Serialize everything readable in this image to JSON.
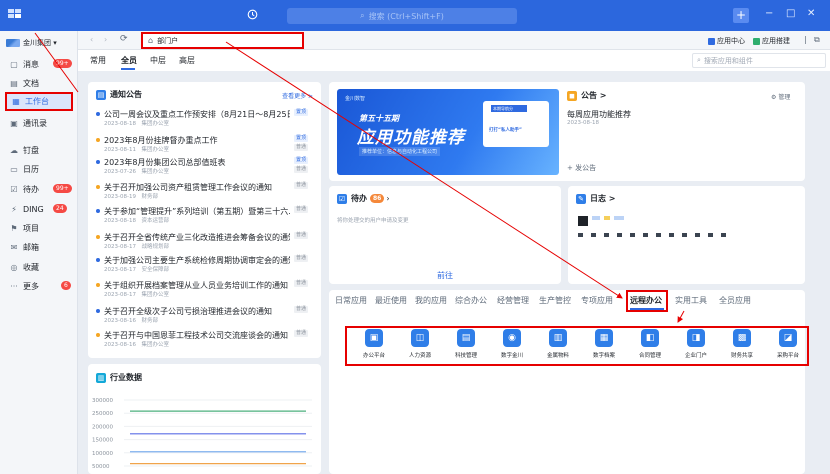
{
  "titlebar": {
    "search_placeholder": "搜索 (Ctrl+Shift+F)",
    "plus": "+",
    "minimize": "−",
    "maximize": "□",
    "close": "✕",
    "history_icon": "clock-icon"
  },
  "sidebar": {
    "org_name": "金川集团 ▾",
    "items": [
      {
        "label": "消息",
        "icon": "message-icon",
        "badge": "99+"
      },
      {
        "label": "文档",
        "icon": "document-icon"
      },
      {
        "label": "工作台",
        "icon": "grid-icon",
        "active": true
      },
      {
        "label": "通讯录",
        "icon": "contacts-icon"
      },
      {
        "label": "钉盘",
        "icon": "cloud-drive-icon"
      },
      {
        "label": "日历",
        "icon": "calendar-icon"
      },
      {
        "label": "待办",
        "icon": "todo-icon",
        "badge": "99+"
      },
      {
        "label": "DING",
        "icon": "ding-icon",
        "badge": "24"
      },
      {
        "label": "项目",
        "icon": "project-icon"
      },
      {
        "label": "邮箱",
        "icon": "mail-icon"
      },
      {
        "label": "收藏",
        "icon": "favorite-icon"
      },
      {
        "label": "更多",
        "icon": "more-icon",
        "badge": "6"
      }
    ]
  },
  "tabstrip": {
    "back": "‹",
    "forward": "›",
    "page_tab_label": "部门户",
    "app_center": "应用中心",
    "app_build": "应用搭建"
  },
  "subtabs": {
    "tabs": [
      "常用",
      "全员",
      "中层",
      "高层"
    ],
    "active": "全员",
    "search_placeholder": "搜索应用和组件"
  },
  "notice": {
    "title": "通知公告",
    "more": "查看更多 >",
    "items": [
      {
        "title": "公司一周会议及重点工作预安排（8月21日～8月25日）",
        "meta": "2023-08-18　集团办公室",
        "tag": "置顶",
        "tag2": "",
        "dot": "#2f6ae0"
      },
      {
        "title": "2023年8月份挂牌督办重点工作",
        "meta": "2023-08-11　集团办公室",
        "tag": "置顶",
        "tag2": "普通",
        "dot": "#f5a623"
      },
      {
        "title": "2023年8月份集团公司总部值班表",
        "meta": "2023-07-26　集团办公室",
        "tag": "置顶",
        "tag2": "普通",
        "dot": "#2f6ae0"
      },
      {
        "title": "关于召开加强公司资产租赁管理工作会议的通知",
        "meta": "2023-08-19　财务部",
        "tag": "普通",
        "tag2": "",
        "dot": "#f5a623"
      },
      {
        "title": "关于参加“管理提升”系列培训（第五期）暨第三十六...",
        "meta": "2023-08-18　资本运营部",
        "tag": "普通",
        "tag2": "",
        "dot": "#2f6ae0"
      },
      {
        "title": "关于召开全省传统产业三化改造推进会筹备会议的通知",
        "meta": "2023-08-17　战略规划部",
        "tag": "普通",
        "tag2": "",
        "dot": "#f5a623"
      },
      {
        "title": "关于加强公司主要生产系统检修周期协调审定会的通知",
        "meta": "2023-08-17　安全保障部",
        "tag": "普通",
        "tag2": "",
        "dot": "#2f6ae0"
      },
      {
        "title": "关于组织开展档案管理从业人员业务培训工作的通知",
        "meta": "2023-08-17　集团办公室",
        "tag": "普通",
        "tag2": "",
        "dot": "#f5a623"
      },
      {
        "title": "关于召开全级次子公司亏损治理推进会议的通知",
        "meta": "2023-08-16　财务部",
        "tag": "普通",
        "tag2": "",
        "dot": "#2f6ae0"
      },
      {
        "title": "关于召开与中国恩菲工程技术公司交流座谈会的通知",
        "meta": "2023-08-16　集团办公室",
        "tag": "普通",
        "tag2": "",
        "dot": "#f5a623"
      }
    ]
  },
  "banner": {
    "logo": "金川数智",
    "small": "第五十五期",
    "big": "应用功能推荐",
    "sub": "推荐单位：信息与自动化工程公司",
    "card_head": "本期导航分",
    "card_text": "打打“私人助手”"
  },
  "announce": {
    "title": "公告 >",
    "manage": "管理",
    "item_title": "每周应用功能推荐",
    "item_date": "2023-08-18",
    "publish": "+ 发公告"
  },
  "todo": {
    "title": "待办",
    "badge": "86",
    "empty_text": "将你处理交的用户申请及变更",
    "go": "前往"
  },
  "diary": {
    "title": "日志 >"
  },
  "industry": {
    "title": "行业数据"
  },
  "chart_data": {
    "type": "line",
    "title": "行业数据",
    "yticks": [
      "300000",
      "250000",
      "200000",
      "150000",
      "100000",
      "50000"
    ],
    "ylim": [
      50000,
      300000
    ],
    "series": [
      {
        "color": "#4caf7d",
        "values": [
          258000,
          258000,
          258000,
          258000,
          258000
        ]
      },
      {
        "color": "#5b6ee6",
        "values": [
          172000,
          172000,
          172000,
          172000,
          172000
        ]
      },
      {
        "color": "#7fb0ee",
        "values": [
          104000,
          104000,
          104000,
          104000,
          104000
        ]
      },
      {
        "color": "#f0a44a",
        "values": [
          59000,
          59000,
          59000,
          59000,
          59000
        ]
      }
    ]
  },
  "apps": {
    "categories": [
      "日常应用",
      "最近使用",
      "我的应用",
      "综合办公",
      "经营管理",
      "生产管控",
      "专项应用",
      "远程办公",
      "实用工具",
      "全员应用"
    ],
    "active_category": "远程办公",
    "items": [
      {
        "label": "办公平台",
        "icon": "office-icon"
      },
      {
        "label": "人力资源",
        "icon": "hr-icon"
      },
      {
        "label": "科技管理",
        "icon": "tech-icon"
      },
      {
        "label": "数字金川",
        "icon": "digital-icon"
      },
      {
        "label": "金属物料",
        "icon": "material-icon"
      },
      {
        "label": "数字档案",
        "icon": "archive-icon"
      },
      {
        "label": "合同管理",
        "icon": "contract-icon"
      },
      {
        "label": "企业门户",
        "icon": "portal-icon"
      },
      {
        "label": "财务共享",
        "icon": "finance-icon"
      },
      {
        "label": "采购平台",
        "icon": "purchase-icon"
      }
    ]
  }
}
